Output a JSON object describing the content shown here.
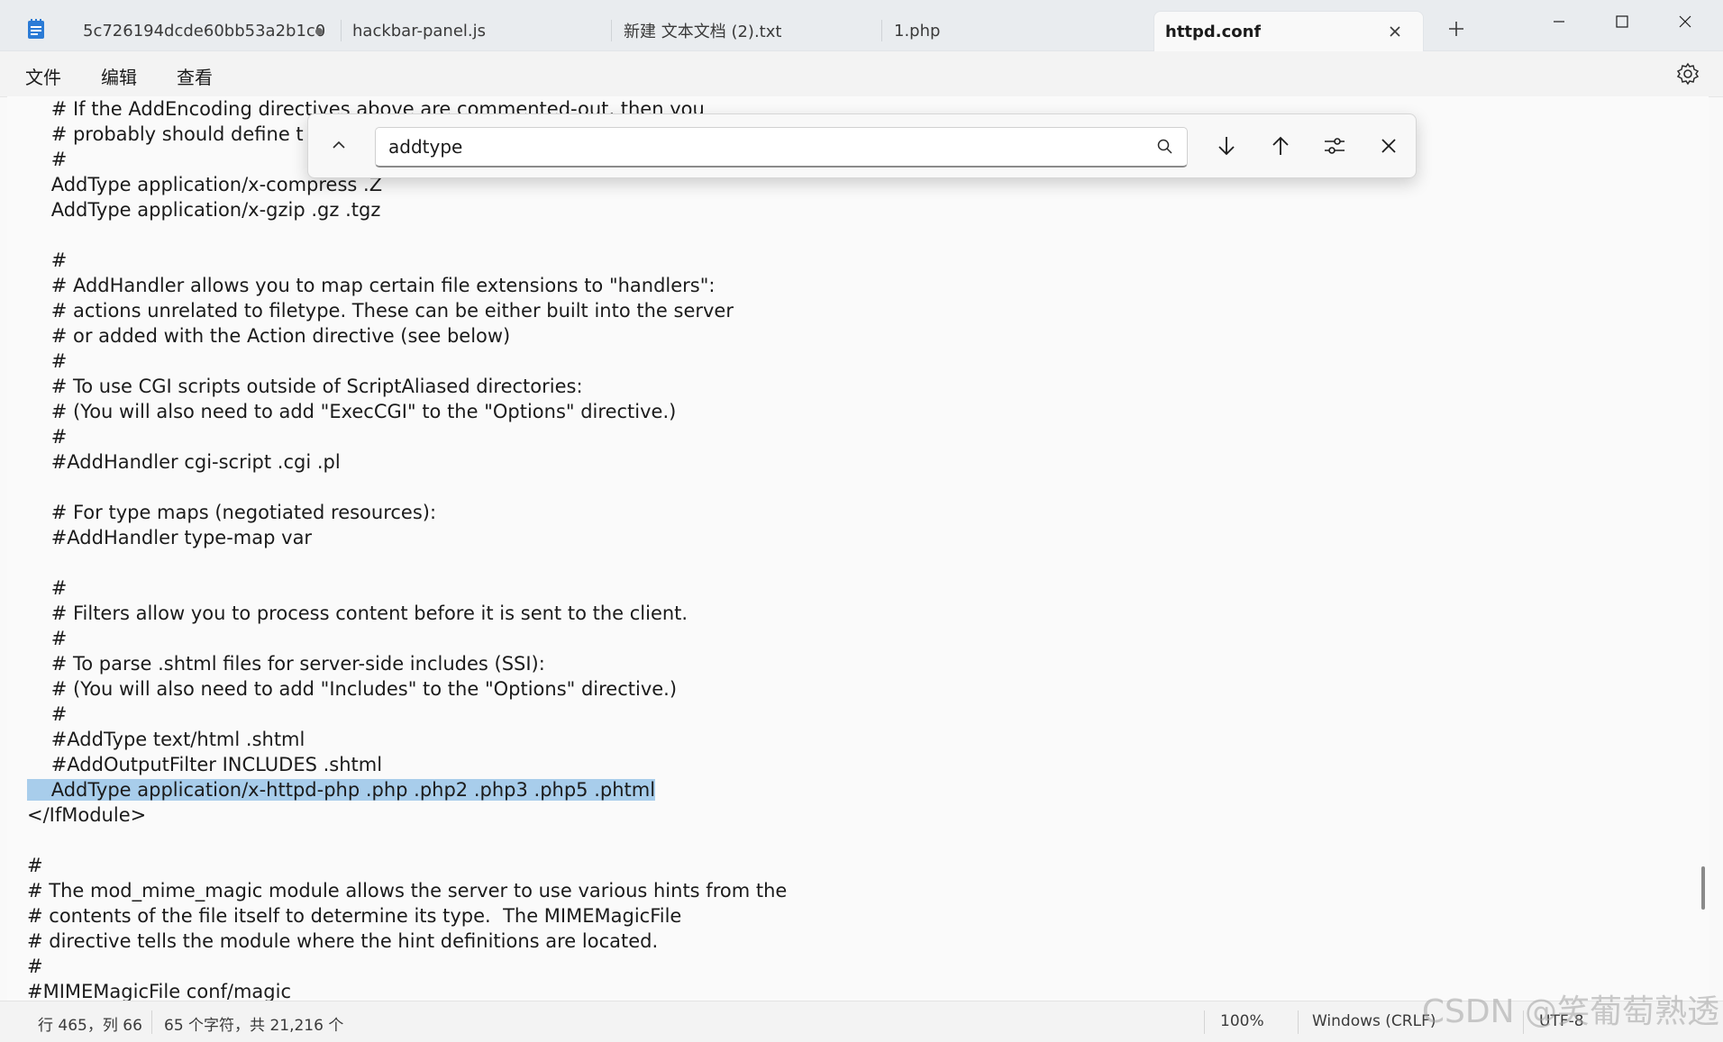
{
  "tabs": [
    {
      "label": "5c726194dcde60bb53a2b1c0",
      "modified": true
    },
    {
      "label": "hackbar-panel.js"
    },
    {
      "label": "新建 文本文档 (2).txt"
    },
    {
      "label": "1.php"
    },
    {
      "label": "httpd.conf",
      "active": true
    }
  ],
  "menu": {
    "file": "文件",
    "edit": "编辑",
    "view": "查看"
  },
  "find": {
    "query": "addtype"
  },
  "code_lines": [
    "    # If the AddEncoding directives above are commented-out, then you",
    "    # probably should define t",
    "    #",
    "    AddType application/x-compress .Z",
    "    AddType application/x-gzip .gz .tgz",
    "",
    "    #",
    "    # AddHandler allows you to map certain file extensions to \"handlers\":",
    "    # actions unrelated to filetype. These can be either built into the server",
    "    # or added with the Action directive (see below)",
    "    #",
    "    # To use CGI scripts outside of ScriptAliased directories:",
    "    # (You will also need to add \"ExecCGI\" to the \"Options\" directive.)",
    "    #",
    "    #AddHandler cgi-script .cgi .pl",
    "",
    "    # For type maps (negotiated resources):",
    "    #AddHandler type-map var",
    "",
    "    #",
    "    # Filters allow you to process content before it is sent to the client.",
    "    #",
    "    # To parse .shtml files for server-side includes (SSI):",
    "    # (You will also need to add \"Includes\" to the \"Options\" directive.)",
    "    #",
    "    #AddType text/html .shtml",
    "    #AddOutputFilter INCLUDES .shtml",
    "    AddType application/x-httpd-php .php .php2 .php3 .php5 .phtml",
    "</IfModule>",
    "",
    "#",
    "# The mod_mime_magic module allows the server to use various hints from the",
    "# contents of the file itself to determine its type.  The MIMEMagicFile",
    "# directive tells the module where the hint definitions are located.",
    "#",
    "#MIMEMagicFile conf/magic"
  ],
  "highlighted_line": 27,
  "status": {
    "position": "行 465，列 66",
    "chars": "65 个字符，共 21,216 个",
    "zoom": "100%",
    "line_ending": "Windows (CRLF)",
    "encoding": "UTF-8"
  },
  "watermark": "CSDN @笑葡萄熟透",
  "colors": {
    "selection": "#a8cdeb",
    "tab_active_bg": "#f9f9f9"
  }
}
